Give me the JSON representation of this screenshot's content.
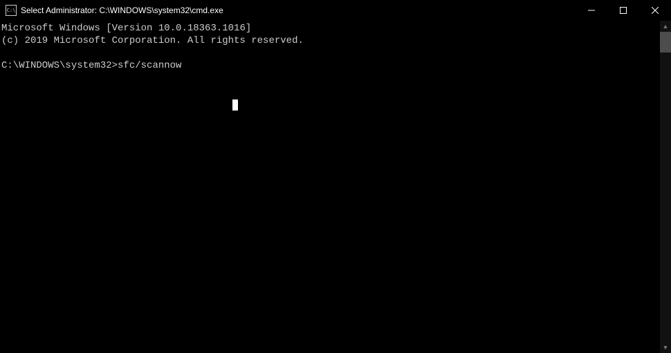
{
  "titlebar": {
    "icon_label": "C:\\",
    "title": "Select Administrator: C:\\WINDOWS\\system32\\cmd.exe"
  },
  "terminal": {
    "line1": "Microsoft Windows [Version 10.0.18363.1016]",
    "line2": "(c) 2019 Microsoft Corporation. All rights reserved.",
    "blank": "",
    "prompt": "C:\\WINDOWS\\system32>",
    "command": "sfc/scannow"
  }
}
